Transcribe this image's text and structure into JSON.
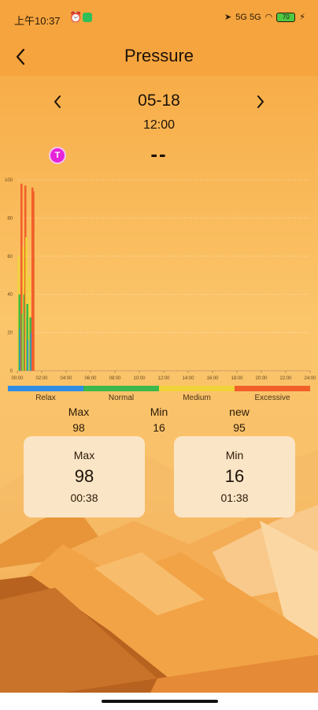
{
  "status_bar": {
    "time": "上午10:37",
    "alarm_icon": "alarm-clock-icon",
    "right_text": "5G 5G",
    "battery": "70"
  },
  "header": {
    "title": "Pressure",
    "back_icon": "chevron-left-icon"
  },
  "date_nav": {
    "date": "05-18",
    "time": "12:00",
    "prev_icon": "chevron-left-icon",
    "next_icon": "chevron-right-icon"
  },
  "current": {
    "badge": "T",
    "value": "--"
  },
  "colors": {
    "relax": "#2f8de4",
    "normal": "#3db84a",
    "medium": "#f0d23a",
    "excessive": "#f2602a"
  },
  "chart_data": {
    "type": "bar",
    "y_ticks": [
      "100",
      "80",
      "60",
      "40",
      "20",
      "0"
    ],
    "ylim": [
      0,
      100
    ],
    "x_ticks": [
      "00:00",
      "02:00",
      "04:00",
      "06:00",
      "08:00",
      "10:00",
      "12:00",
      "14:00",
      "16:00",
      "18:00",
      "20:00",
      "22:00",
      "24:00"
    ],
    "xlim_hours": [
      0,
      24
    ],
    "bars": [
      {
        "t": 0.1,
        "value": 60,
        "level": "medium"
      },
      {
        "t": 0.18,
        "value": 40,
        "level": "normal"
      },
      {
        "t": 0.26,
        "value": 22,
        "level": "relax"
      },
      {
        "t": 0.34,
        "value": 98,
        "level": "excessive"
      },
      {
        "t": 0.42,
        "value": 30,
        "level": "normal"
      },
      {
        "t": 0.5,
        "value": 65,
        "level": "medium"
      },
      {
        "t": 0.58,
        "value": 40,
        "level": "normal"
      },
      {
        "t": 0.66,
        "value": 97,
        "level": "excessive"
      },
      {
        "t": 0.74,
        "value": 70,
        "level": "medium"
      },
      {
        "t": 0.82,
        "value": 35,
        "level": "normal"
      },
      {
        "t": 0.9,
        "value": 16,
        "level": "relax"
      },
      {
        "t": 1.0,
        "value": 50,
        "level": "medium"
      },
      {
        "t": 1.08,
        "value": 28,
        "level": "normal"
      },
      {
        "t": 1.16,
        "value": 20,
        "level": "relax"
      },
      {
        "t": 1.24,
        "value": 96,
        "level": "excessive"
      },
      {
        "t": 1.32,
        "value": 94,
        "level": "excessive"
      }
    ],
    "grid": true
  },
  "scale": {
    "labels": [
      "Relax",
      "Normal",
      "Medium",
      "Excessive"
    ]
  },
  "summary": {
    "max_label": "Max",
    "max_value": "98",
    "min_label": "Min",
    "min_value": "16",
    "new_label": "new",
    "new_value": "95"
  },
  "cards": {
    "max": {
      "title": "Max",
      "value": "98",
      "time": "00:38"
    },
    "min": {
      "title": "Min",
      "value": "16",
      "time": "01:38"
    }
  }
}
